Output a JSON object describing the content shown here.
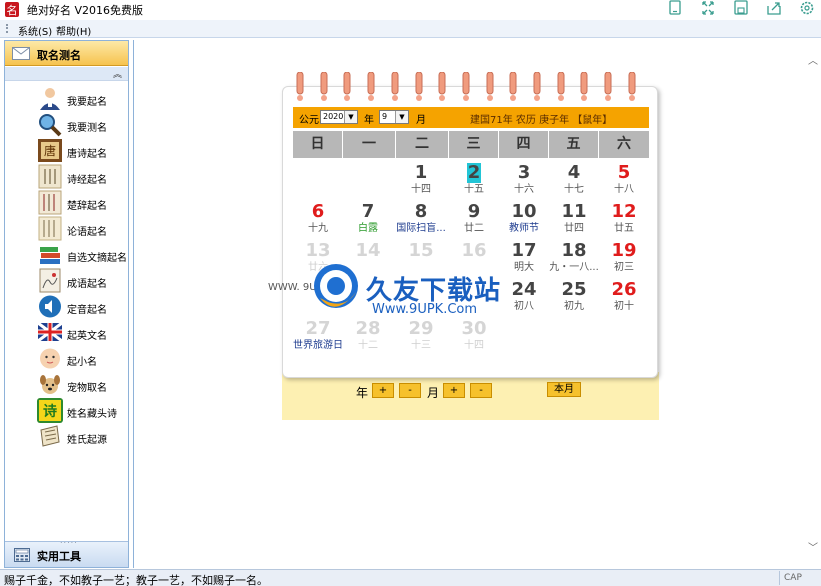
{
  "window": {
    "title": "绝对好名 V2016免费版",
    "toolbar_icons": [
      "phone-icon",
      "fullscreen-icon",
      "save-icon",
      "share-icon",
      "settings-icon"
    ]
  },
  "menu": {
    "items": [
      "系统(S)",
      "帮助(H)"
    ]
  },
  "sidebar": {
    "header": "取名测名",
    "collapse_glyph": "︽",
    "items": [
      {
        "label": "我要起名",
        "icon": "person-icon"
      },
      {
        "label": "我要测名",
        "icon": "magnifier-icon"
      },
      {
        "label": "唐诗起名",
        "icon": "tang-scroll-icon"
      },
      {
        "label": "诗经起名",
        "icon": "book-icon"
      },
      {
        "label": "楚辞起名",
        "icon": "book-icon"
      },
      {
        "label": "论语起名",
        "icon": "book-icon"
      },
      {
        "label": "自选文摘起名",
        "icon": "books-stack-icon"
      },
      {
        "label": "成语起名",
        "icon": "painting-icon"
      },
      {
        "label": "定音起名",
        "icon": "sound-icon"
      },
      {
        "label": "起英文名",
        "icon": "flag-icon"
      },
      {
        "label": "起小名",
        "icon": "baby-icon"
      },
      {
        "label": "宠物取名",
        "icon": "dog-icon"
      },
      {
        "label": "姓名藏头诗",
        "icon": "poem-icon"
      },
      {
        "label": "姓氏起源",
        "icon": "scroll-icon"
      }
    ],
    "footer": "实用工具"
  },
  "calendar": {
    "prefix": "公元",
    "year_value": "2020",
    "year_label": "年",
    "month_value": "9",
    "month_label": "月",
    "lunar_info": "建国71年  农历  庚子年 【鼠年】",
    "weekdays": [
      "日",
      "一",
      "二",
      "三",
      "四",
      "五",
      "六"
    ],
    "days": [
      {
        "n": "1",
        "l": "十四",
        "col": 2,
        "row": 0
      },
      {
        "n": "2",
        "l": "十五",
        "col": 3,
        "row": 0,
        "today": true
      },
      {
        "n": "3",
        "l": "十六",
        "col": 4,
        "row": 0
      },
      {
        "n": "4",
        "l": "十七",
        "col": 5,
        "row": 0
      },
      {
        "n": "5",
        "l": "十八",
        "col": 6,
        "row": 0,
        "red": true
      },
      {
        "n": "6",
        "l": "十九",
        "col": 0,
        "row": 1,
        "red": true
      },
      {
        "n": "7",
        "l": "白露",
        "col": 1,
        "row": 1,
        "lcolor": "green"
      },
      {
        "n": "8",
        "l": "国际扫盲...",
        "col": 2,
        "row": 1,
        "lcolor": "blue"
      },
      {
        "n": "9",
        "l": "廿二",
        "col": 3,
        "row": 1
      },
      {
        "n": "10",
        "l": "教师节",
        "col": 4,
        "row": 1,
        "lcolor": "blue"
      },
      {
        "n": "11",
        "l": "廿四",
        "col": 5,
        "row": 1
      },
      {
        "n": "12",
        "l": "廿五",
        "col": 6,
        "row": 1,
        "red": true
      },
      {
        "n": "13",
        "l": "廿六",
        "col": 0,
        "row": 2,
        "red": true,
        "faded": true
      },
      {
        "n": "14",
        "l": "",
        "col": 1,
        "row": 2,
        "faded": true
      },
      {
        "n": "15",
        "l": "",
        "col": 2,
        "row": 2,
        "faded": true
      },
      {
        "n": "16",
        "l": "",
        "col": 3,
        "row": 2,
        "faded": true
      },
      {
        "n": "17",
        "l": "明大",
        "col": 4,
        "row": 2
      },
      {
        "n": "18",
        "l": "九・一八...",
        "col": 5,
        "row": 2
      },
      {
        "n": "19",
        "l": "初三",
        "col": 6,
        "row": 2,
        "red": true
      },
      {
        "n": "24",
        "l": "初八",
        "col": 4,
        "row": 3
      },
      {
        "n": "25",
        "l": "初九",
        "col": 5,
        "row": 3
      },
      {
        "n": "26",
        "l": "初十",
        "col": 6,
        "row": 3,
        "red": true
      },
      {
        "n": "27",
        "l": "世界旅游日",
        "col": 0,
        "row": 4,
        "red": true,
        "faded": true,
        "lcolor": "blue"
      },
      {
        "n": "28",
        "l": "十二",
        "col": 1,
        "row": 4,
        "faded": true
      },
      {
        "n": "29",
        "l": "十三",
        "col": 2,
        "row": 4,
        "faded": true
      },
      {
        "n": "30",
        "l": "十四",
        "col": 3,
        "row": 4,
        "faded": true
      }
    ],
    "nav": {
      "year_label": "年",
      "month_label": "月",
      "plus": "+",
      "minus": "-",
      "today_label": "本月"
    }
  },
  "watermark": {
    "title": "久友下载站",
    "url": "Www.9UPK.Com",
    "small": "WWW. 9UPK. Com"
  },
  "status": {
    "text": "赐子千金，不如教子一艺；教子一艺，不如赐子一名。",
    "cap": "CAP"
  },
  "colors": {
    "header_orange": "#f5a300",
    "weekday_gray": "#b7b7b7",
    "holiday_red": "#e01c1c",
    "today_cyan": "#22c5d6",
    "sidebar_header": "#f6c34f"
  }
}
